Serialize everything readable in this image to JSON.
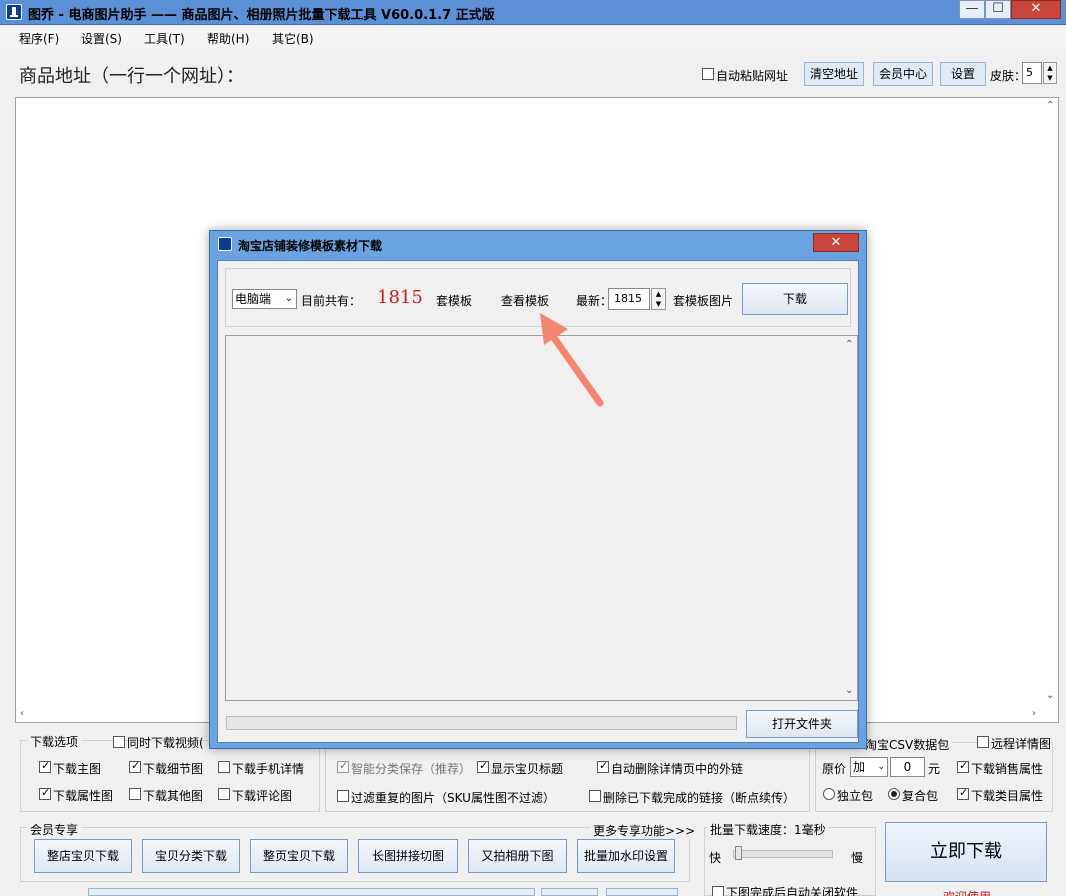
{
  "window": {
    "title": "图乔 - 电商图片助手 —— 商品图片、相册照片批量下载工具 V60.0.1.7 正式版",
    "min_glyph": "—",
    "max_glyph": "☐",
    "close_glyph": "✕"
  },
  "menu": [
    "程序(F)",
    "设置(S)",
    "工具(T)",
    "帮助(H)",
    "其它(B)"
  ],
  "header": {
    "label": "商品地址（一行一个网址）：",
    "auto_paste": "自动粘贴网址",
    "clear_btn": "清空地址",
    "member_btn": "会员中心",
    "settings_btn": "设置",
    "skin_label": "皮肤：",
    "skin_value": "5"
  },
  "dialog": {
    "title": "淘宝店铺装修模板素材下载",
    "platform": "电脑端",
    "current_total_label": "目前共有：",
    "count": "1815",
    "unit_label": "套模板",
    "view_link": "查看模板",
    "latest_label": "最新：",
    "latest_value": "1815",
    "latest_suffix": "套模板图片",
    "download_btn": "下载",
    "open_folder_btn": "打开文件夹"
  },
  "download_options": {
    "title": "下载选项",
    "video_label": "同时下载视频(",
    "items": [
      {
        "label": "下载主图",
        "checked": true
      },
      {
        "label": "下载细节图",
        "checked": true
      },
      {
        "label": "下载手机详情",
        "checked": false
      },
      {
        "label": "下载属性图",
        "checked": true
      },
      {
        "label": "下载其他图",
        "checked": false
      },
      {
        "label": "下载评论图",
        "checked": false
      }
    ]
  },
  "middle_options": {
    "smart_save": "智能分类保存（推荐）",
    "show_title": "显示宝贝标题",
    "auto_delete_links": "自动删除详情页中的外链",
    "filter_duplicates": "过滤重复的图片（SKU属性图不过滤）",
    "delete_completed": "删除已下载完成的链接（断点续传）"
  },
  "csv_options": {
    "csv_label": "淘宝CSV数据包",
    "remote_detail": "远程详情图",
    "price_label": "原价",
    "price_op": "加",
    "price_value": "0",
    "price_unit": "元",
    "sales_attr": "下载销售属性",
    "independent": "独立包",
    "combined": "复合包",
    "category_attr": "下载类目属性"
  },
  "member": {
    "title": "会员专享",
    "more": "更多专享功能>>>",
    "buttons": [
      "整店宝贝下载",
      "宝贝分类下载",
      "整页宝贝下载",
      "长图拼接切图",
      "又拍相册下图",
      "批量加水印设置"
    ]
  },
  "speed": {
    "label": "批量下载速度：1毫秒",
    "fast": "快",
    "slow": "慢",
    "auto_close": "下图完成后自动关闭软件",
    "slider_level": 0.02
  },
  "start_btn": "立即下载",
  "welcome": "欢迎使用"
}
